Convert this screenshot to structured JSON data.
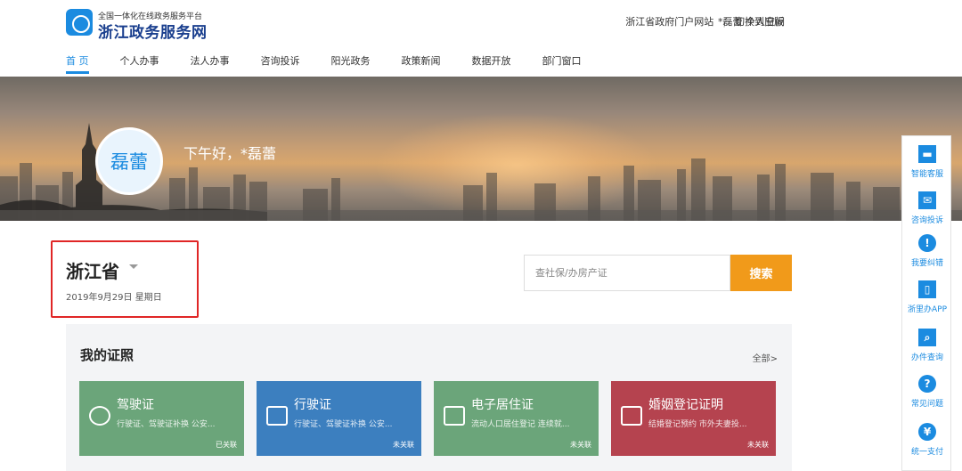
{
  "header": {
    "logo_subtitle": "全国一体化在线政务服务平台",
    "logo_title": "浙江政务服务网",
    "links": [
      "浙江省政府门户网站",
      "切换到旧版"
    ],
    "user_link": "*磊蕾 个人空间"
  },
  "nav": {
    "items": [
      "首 页",
      "个人办事",
      "法人办事",
      "咨询投诉",
      "阳光政务",
      "政策新闻",
      "数据开放",
      "部门窗口"
    ],
    "active": "首 页"
  },
  "banner": {
    "avatar_text": "磊蕾",
    "greeting": "下午好，*磊蕾"
  },
  "location": {
    "province": "浙江省",
    "date": "2019年9月29日 星期日"
  },
  "search": {
    "placeholder": "查社保/办房产证",
    "button": "搜索"
  },
  "certificates": {
    "title": "我的证照",
    "all_link": "全部>",
    "cards": [
      {
        "name": "驾驶证",
        "desc": "行驶证、驾驶证补换  公安...",
        "status": "已关联",
        "color": "#6ba57a",
        "icon": "steering-wheel-icon"
      },
      {
        "name": "行驶证",
        "desc": "行驶证、驾驶证补换  公安...",
        "status": "未关联",
        "color": "#3c7fbf",
        "icon": "car-icon"
      },
      {
        "name": "电子居住证",
        "desc": "流动人口居住登记  连续就...",
        "status": "未关联",
        "color": "#6ba57a",
        "icon": "building-icon"
      },
      {
        "name": "婚姻登记证明",
        "desc": "结婚登记预约  市外夫妻投...",
        "status": "未关联",
        "color": "#b5434f",
        "icon": "certificate-icon"
      }
    ]
  },
  "side_tools": [
    {
      "label": "智能客服",
      "icon": "chat-icon"
    },
    {
      "label": "咨询投诉",
      "icon": "mail-icon"
    },
    {
      "label": "我要纠错",
      "icon": "alert-icon"
    },
    {
      "label": "浙里办APP",
      "icon": "phone-icon"
    },
    {
      "label": "办件查询",
      "icon": "search-icon"
    },
    {
      "label": "常见问题",
      "icon": "question-icon"
    },
    {
      "label": "统一支付",
      "icon": "payment-icon"
    }
  ],
  "colors": {
    "brand_blue": "#1b8be0",
    "search_orange": "#f19a1a",
    "highlight_red": "#e02626"
  }
}
